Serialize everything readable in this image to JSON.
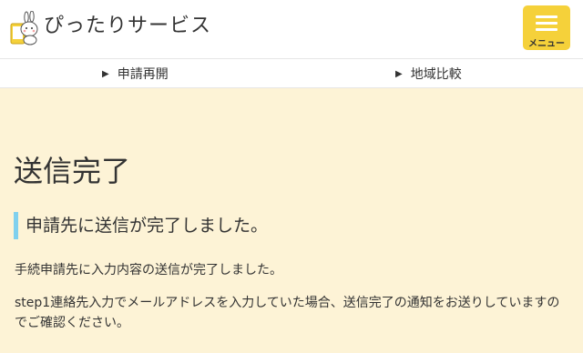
{
  "header": {
    "brand": "ぴったりサービス",
    "menu_label": "メニュー",
    "logo_icon": "rabbit-smartphone-logo-icon",
    "menu_icon": "hamburger-menu-icon",
    "accent_color": "#f5d13a"
  },
  "subnav": {
    "items": [
      {
        "label": "申請再開",
        "icon": "triangle-right-icon"
      },
      {
        "label": "地域比較",
        "icon": "triangle-right-icon"
      }
    ]
  },
  "main": {
    "title": "送信完了",
    "heading": "申請先に送信が完了しました。",
    "paragraph1": "手続申請先に入力内容の送信が完了しました。",
    "paragraph2": "step1連絡先入力でメールアドレスを入力していた場合、送信完了の通知をお送りしていますのでご確認ください。",
    "background_color": "#fdf3d6",
    "heading_accent_color": "#7fd0ee"
  }
}
